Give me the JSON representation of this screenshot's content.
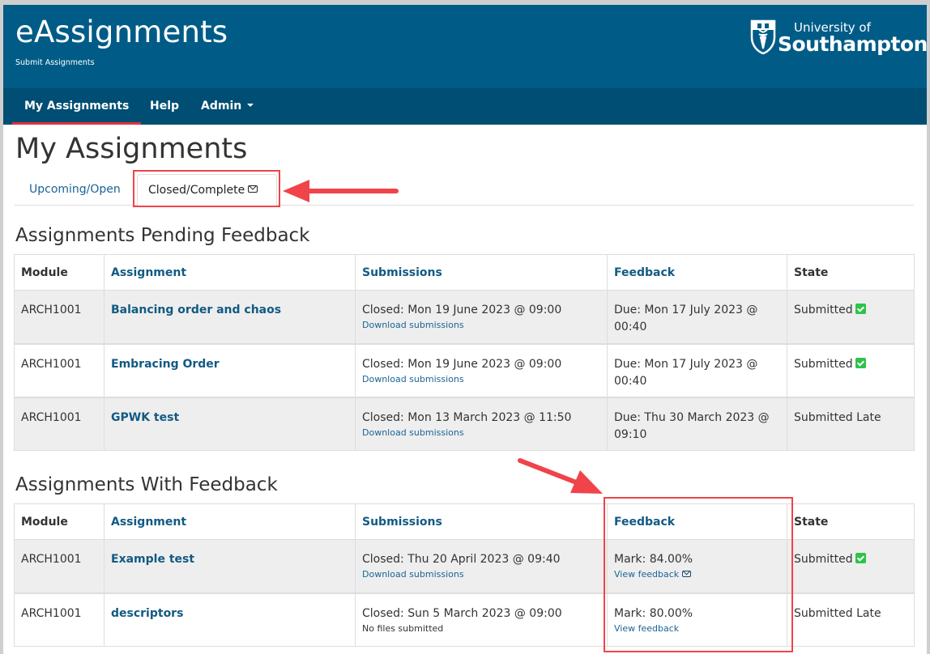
{
  "header": {
    "app_title": "eAssignments",
    "app_subtitle": "Submit Assignments",
    "logo": {
      "line1": "University of",
      "line2": "Southampton"
    }
  },
  "nav": {
    "items": [
      {
        "label": "My Assignments",
        "active": true
      },
      {
        "label": "Help"
      },
      {
        "label": "Admin",
        "has_dropdown": true
      }
    ]
  },
  "page": {
    "title": "My Assignments",
    "tabs": [
      {
        "label": "Upcoming/Open",
        "active": false
      },
      {
        "label": "Closed/Complete",
        "active": true,
        "icon": "envelope-icon"
      }
    ]
  },
  "pending": {
    "title": "Assignments Pending Feedback",
    "columns": [
      "Module",
      "Assignment",
      "Submissions",
      "Feedback",
      "State"
    ],
    "rows": [
      {
        "module": "ARCH1001",
        "assignment": "Balancing order and chaos",
        "submission": "Closed: Mon 19 June 2023 @ 09:00",
        "submission_link": "Download submissions",
        "feedback": "Due: Mon 17 July 2023 @ 00:40",
        "state": "Submitted",
        "state_icon": "check-icon"
      },
      {
        "module": "ARCH1001",
        "assignment": "Embracing Order",
        "submission": "Closed: Mon 19 June 2023 @ 09:00",
        "submission_link": "Download submissions",
        "feedback": "Due: Mon 17 July 2023 @ 00:40",
        "state": "Submitted",
        "state_icon": "check-icon"
      },
      {
        "module": "ARCH1001",
        "assignment": "GPWK test",
        "submission": "Closed: Mon 13 March 2023 @ 11:50",
        "submission_link": "Download submissions",
        "feedback": "Due: Thu 30 March 2023 @ 09:10",
        "state": "Submitted Late"
      }
    ]
  },
  "with_feedback": {
    "title": "Assignments With Feedback",
    "columns": [
      "Module",
      "Assignment",
      "Submissions",
      "Feedback",
      "State"
    ],
    "rows": [
      {
        "module": "ARCH1001",
        "assignment": "Example test",
        "submission": "Closed: Thu 20 April 2023 @ 09:40",
        "submission_link": "Download submissions",
        "mark": "Mark: 84.00%",
        "feedback_link": "View feedback",
        "feedback_icon": "envelope-icon",
        "state": "Submitted",
        "state_icon": "check-icon"
      },
      {
        "module": "ARCH1001",
        "assignment": "descriptors",
        "submission": "Closed: Sun 5 March 2023 @ 09:00",
        "submission_note": "No files submitted",
        "mark": "Mark: 80.00%",
        "feedback_link": "View feedback",
        "state": "Submitted Late"
      }
    ]
  },
  "colors": {
    "header_bg": "#005c87",
    "nav_bg": "#004e73",
    "active_underline": "#e0313b",
    "link": "#125a83",
    "success": "#2fc34a",
    "annotation": "#f0434a"
  }
}
